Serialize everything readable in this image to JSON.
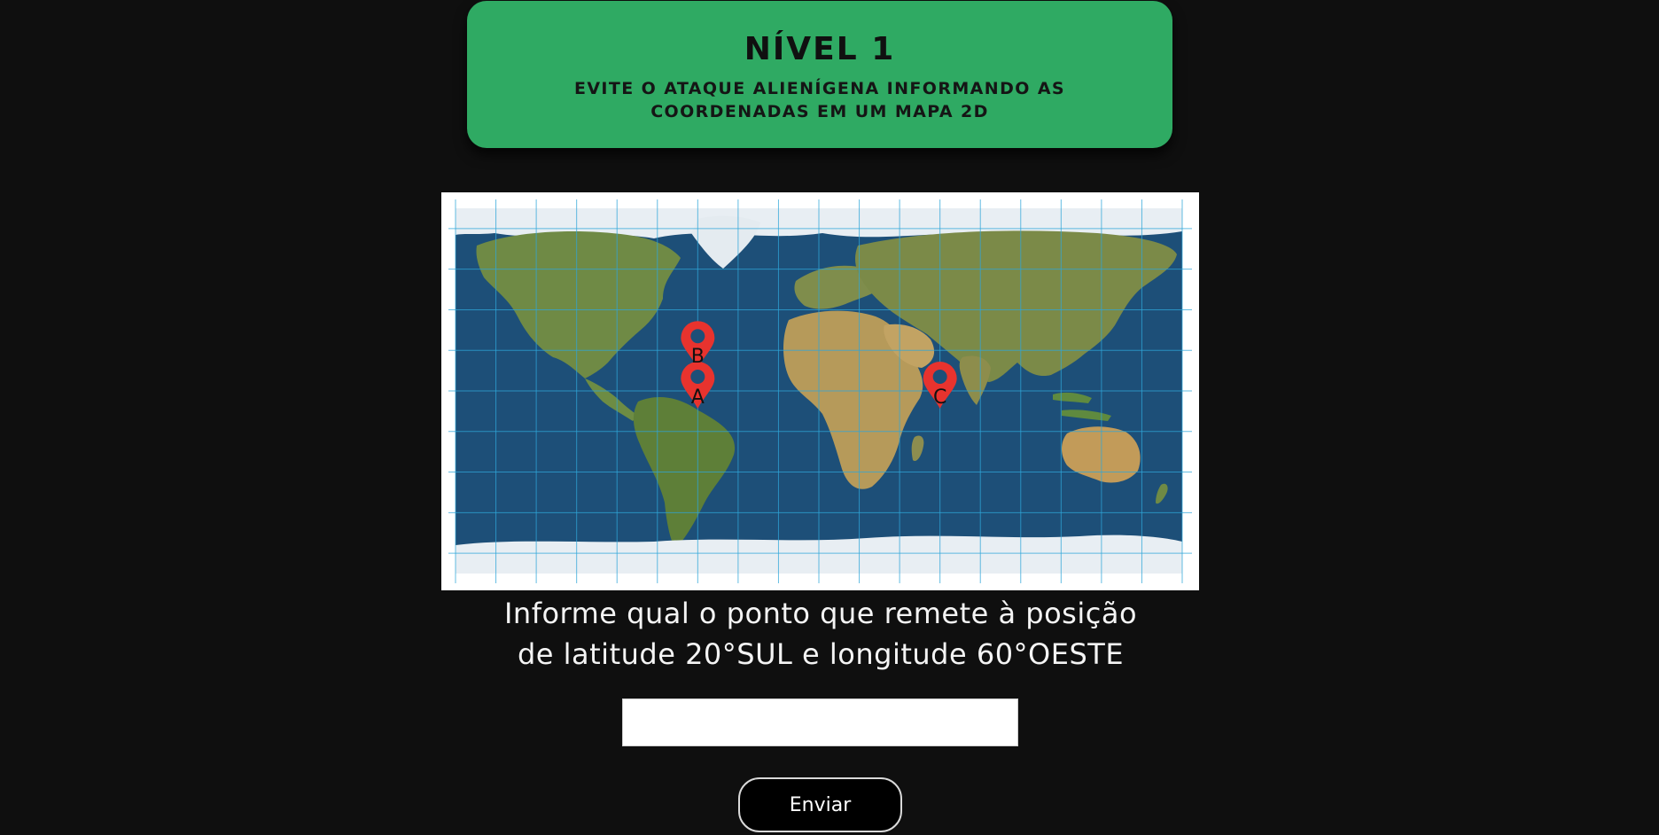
{
  "level": {
    "title": "NÍVEL 1",
    "subtitle": "EVITE O ATAQUE ALIENÍGENA INFORMANDO AS COORDENADAS EM UM MAPA 2D"
  },
  "map": {
    "markers": [
      {
        "label": "A",
        "lat": 0,
        "lon": -60
      },
      {
        "label": "B",
        "lat": 20,
        "lon": -60
      },
      {
        "label": "C",
        "lat": 0,
        "lon": 60
      }
    ],
    "colors": {
      "ocean": "#1d4f78",
      "land": "#6f8a45",
      "ice": "#e8eef3",
      "grid": "#2fa6d9",
      "marker": "#e8332e"
    }
  },
  "question": {
    "line1": "Informe qual o ponto que remete à posição",
    "line2": "de latitude 20°SUL e longitude 60°OESTE"
  },
  "answer": {
    "value": "",
    "placeholder": ""
  },
  "submit": {
    "label": "Enviar"
  },
  "theme": {
    "background": "#0f0f0f",
    "card": "#2faa63"
  }
}
